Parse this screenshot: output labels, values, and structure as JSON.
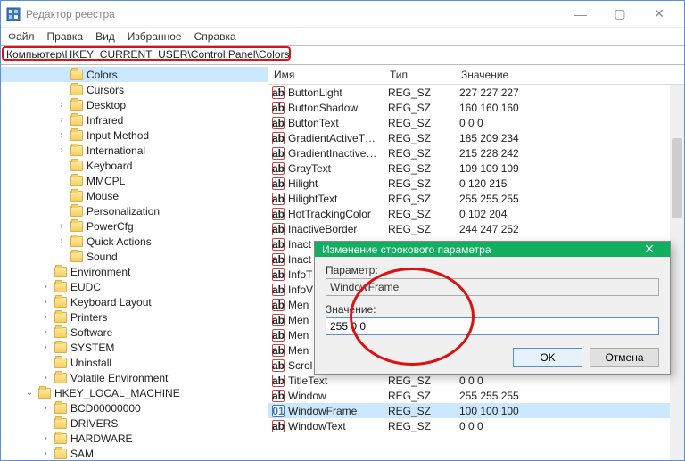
{
  "window": {
    "title": "Редактор реестра"
  },
  "menu": {
    "file": "Файл",
    "edit": "Правка",
    "view": "Вид",
    "fav": "Избранное",
    "help": "Справка"
  },
  "address": "Компьютер\\HKEY_CURRENT_USER\\Control Panel\\Colors",
  "tree": {
    "indent2": [
      {
        "label": "Colors",
        "expander": "",
        "selected": true
      },
      {
        "label": "Cursors",
        "expander": ""
      },
      {
        "label": "Desktop",
        "expander": "›"
      },
      {
        "label": "Infrared",
        "expander": "›"
      },
      {
        "label": "Input Method",
        "expander": "›"
      },
      {
        "label": "International",
        "expander": "›"
      },
      {
        "label": "Keyboard",
        "expander": ""
      },
      {
        "label": "MMCPL",
        "expander": ""
      },
      {
        "label": "Mouse",
        "expander": ""
      },
      {
        "label": "Personalization",
        "expander": ""
      },
      {
        "label": "PowerCfg",
        "expander": "›"
      },
      {
        "label": "Quick Actions",
        "expander": "›"
      },
      {
        "label": "Sound",
        "expander": ""
      }
    ],
    "indent1": [
      {
        "label": "Environment",
        "expander": ""
      },
      {
        "label": "EUDC",
        "expander": "›"
      },
      {
        "label": "Keyboard Layout",
        "expander": "›"
      },
      {
        "label": "Printers",
        "expander": "›"
      },
      {
        "label": "Software",
        "expander": "›"
      },
      {
        "label": "SYSTEM",
        "expander": "›"
      },
      {
        "label": "Uninstall",
        "expander": ""
      },
      {
        "label": "Volatile Environment",
        "expander": "›"
      }
    ],
    "hklm": {
      "label": "HKEY_LOCAL_MACHINE",
      "expander": "⌄"
    },
    "hklm_children": [
      {
        "label": "BCD00000000",
        "expander": "›"
      },
      {
        "label": "DRIVERS",
        "expander": ""
      },
      {
        "label": "HARDWARE",
        "expander": "›"
      },
      {
        "label": "SAM",
        "expander": "›"
      }
    ]
  },
  "list": {
    "headers": {
      "name": "Имя",
      "type": "Тип",
      "value": "Значение"
    },
    "rows": [
      {
        "ico": "ab",
        "name": "ButtonLight",
        "type": "REG_SZ",
        "value": "227 227 227"
      },
      {
        "ico": "ab",
        "name": "ButtonShadow",
        "type": "REG_SZ",
        "value": "160 160 160"
      },
      {
        "ico": "ab",
        "name": "ButtonText",
        "type": "REG_SZ",
        "value": "0 0 0"
      },
      {
        "ico": "ab",
        "name": "GradientActiveT…",
        "type": "REG_SZ",
        "value": "185 209 234"
      },
      {
        "ico": "ab",
        "name": "GradientInactive…",
        "type": "REG_SZ",
        "value": "215 228 242"
      },
      {
        "ico": "ab",
        "name": "GrayText",
        "type": "REG_SZ",
        "value": "109 109 109"
      },
      {
        "ico": "ab",
        "name": "Hilight",
        "type": "REG_SZ",
        "value": "0 120 215"
      },
      {
        "ico": "ab",
        "name": "HilightText",
        "type": "REG_SZ",
        "value": "255 255 255"
      },
      {
        "ico": "ab",
        "name": "HotTrackingColor",
        "type": "REG_SZ",
        "value": "0 102 204"
      },
      {
        "ico": "ab",
        "name": "InactiveBorder",
        "type": "REG_SZ",
        "value": "244 247 252"
      },
      {
        "ico": "ab",
        "name": "Inact",
        "type": "",
        "value": ""
      },
      {
        "ico": "ab",
        "name": "Inact",
        "type": "",
        "value": ""
      },
      {
        "ico": "ab",
        "name": "InfoT",
        "type": "",
        "value": ""
      },
      {
        "ico": "ab",
        "name": "InfoV",
        "type": "",
        "value": ""
      },
      {
        "ico": "ab",
        "name": "Men",
        "type": "",
        "value": ""
      },
      {
        "ico": "ab",
        "name": "Men",
        "type": "",
        "value": ""
      },
      {
        "ico": "ab",
        "name": "Men",
        "type": "",
        "value": ""
      },
      {
        "ico": "ab",
        "name": "Men",
        "type": "",
        "value": ""
      },
      {
        "ico": "ab",
        "name": "Scrol",
        "type": "",
        "value": ""
      },
      {
        "ico": "ab",
        "name": "TitleText",
        "type": "REG_SZ",
        "value": "0 0 0"
      },
      {
        "ico": "ab",
        "name": "Window",
        "type": "REG_SZ",
        "value": "255 255 255"
      },
      {
        "ico": "bin",
        "name": "WindowFrame",
        "type": "REG_SZ",
        "value": "100 100 100",
        "selected": true
      },
      {
        "ico": "ab",
        "name": "WindowText",
        "type": "REG_SZ",
        "value": "0 0 0"
      }
    ]
  },
  "dialog": {
    "title": "Изменение строкового параметра",
    "param_label": "Параметр:",
    "param_value": "WindowFrame",
    "value_label": "Значение:",
    "value_value": "255 0 0",
    "ok": "OK",
    "cancel": "Отмена"
  }
}
